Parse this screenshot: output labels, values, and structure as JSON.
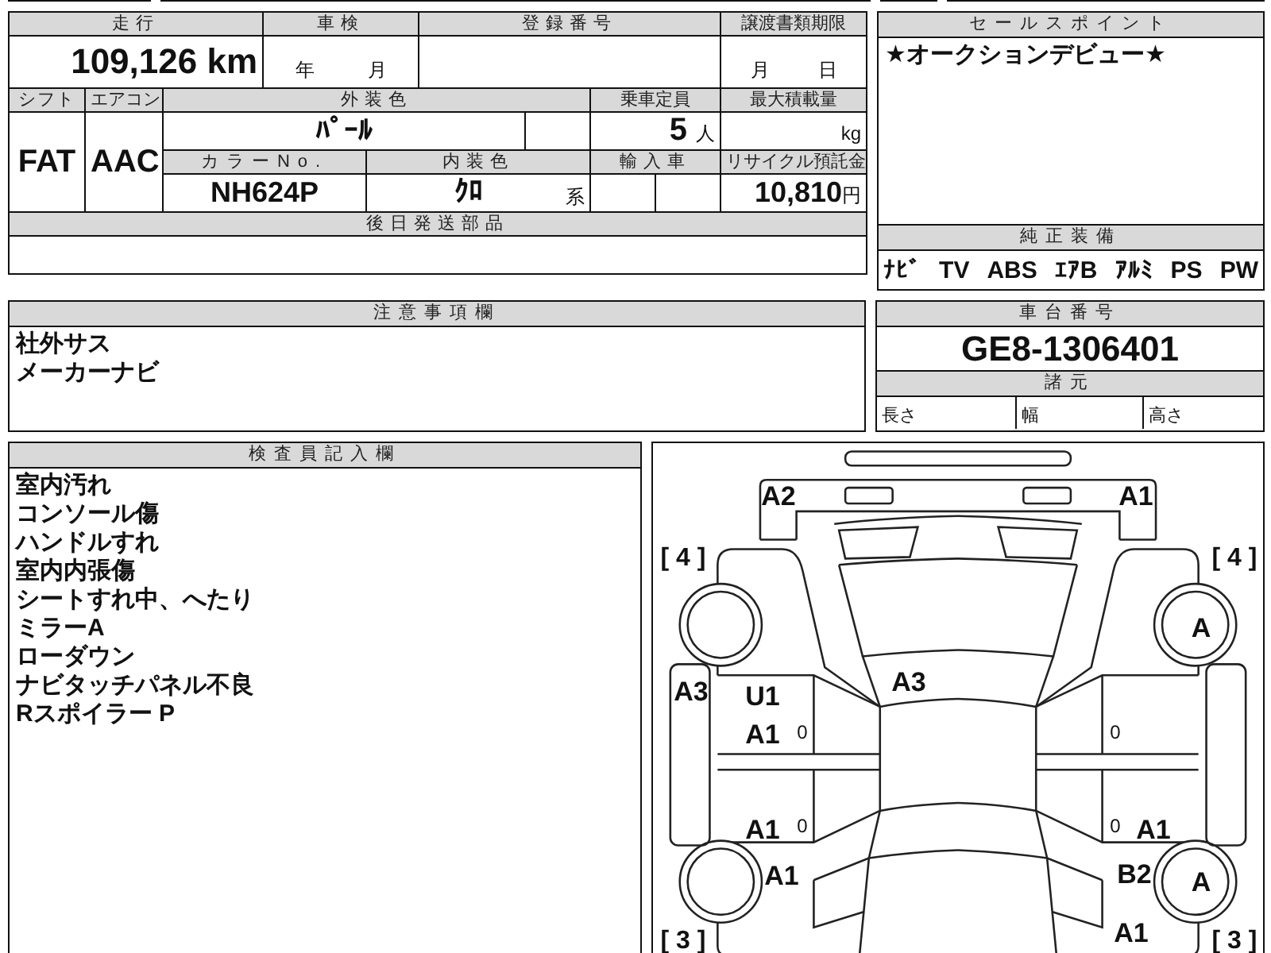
{
  "vehicle": {
    "mileage_label": "走行",
    "mileage": "109,126 km",
    "inspection_label": "車検",
    "inspection_year_unit": "年",
    "inspection_month_unit": "月",
    "registration_label": "登録番号",
    "transfer_label": "譲渡書類期限",
    "transfer_month_unit": "月",
    "transfer_day_unit": "日",
    "shift_label": "シフト",
    "shift": "FAT",
    "aircon_label": "エアコン",
    "aircon": "AAC",
    "exterior_label": "外装色",
    "exterior": "ﾊﾟｰﾙ",
    "capacity_label": "乗車定員",
    "capacity": "5",
    "capacity_unit": "人",
    "load_label": "最大積載量",
    "load_unit": "kg",
    "color_no_label": "カラーNo.",
    "color_no": "NH624P",
    "interior_label": "内装色",
    "interior": "ｸﾛ",
    "interior_suffix": "系",
    "import_label": "輸入車",
    "recycle_label": "リサイクル預託金",
    "recycle": "10,810",
    "recycle_unit": "円",
    "parts_label": "後日発送部品"
  },
  "sales": {
    "label": "セールスポイント",
    "text": "★オークションデビュー★",
    "equipment_label": "純正装備",
    "equipment": [
      "ﾅﾋﾞ",
      "TV",
      "ABS",
      "ｴｱB",
      "ｱﾙﾐ",
      "PS",
      "PW"
    ]
  },
  "notes": {
    "label": "注意事項欄",
    "lines": [
      "社外サス",
      "メーカーナビ"
    ]
  },
  "chassis": {
    "label": "車台番号",
    "number": "GE8-1306401",
    "specs_label": "諸元",
    "specs": [
      "長さ",
      "幅",
      "高さ"
    ]
  },
  "inspector": {
    "label": "検査員記入欄",
    "lines": [
      "室内汚れ",
      "コンソール傷",
      "ハンドルすれ",
      "室内内張傷",
      "シートすれ中、へたり",
      "ミラーA",
      "ローダウン",
      "ナビタッチパネル不良",
      "Rスポイラー P"
    ]
  },
  "diagram": {
    "marks": [
      {
        "text": "A2",
        "kind": "grade"
      },
      {
        "text": "A1",
        "kind": "grade"
      },
      {
        "text": "[ 4 ]",
        "kind": "bracket"
      },
      {
        "text": "[ 4 ]",
        "kind": "bracket"
      },
      {
        "text": "A",
        "kind": "grade"
      },
      {
        "text": "A3",
        "kind": "grade"
      },
      {
        "text": "U1",
        "kind": "grade"
      },
      {
        "text": "A3",
        "kind": "grade"
      },
      {
        "text": "A1",
        "kind": "grade"
      },
      {
        "text": "0",
        "kind": "tick"
      },
      {
        "text": "0",
        "kind": "tick"
      },
      {
        "text": "A1",
        "kind": "grade"
      },
      {
        "text": "0",
        "kind": "tick"
      },
      {
        "text": "0",
        "kind": "tick"
      },
      {
        "text": "A1",
        "kind": "grade"
      },
      {
        "text": "A1",
        "kind": "grade"
      },
      {
        "text": "B2",
        "kind": "grade"
      },
      {
        "text": "A",
        "kind": "grade"
      },
      {
        "text": "[ 3 ]",
        "kind": "bracket"
      },
      {
        "text": "A1",
        "kind": "grade"
      },
      {
        "text": "[ 3 ]",
        "kind": "bracket"
      }
    ]
  }
}
